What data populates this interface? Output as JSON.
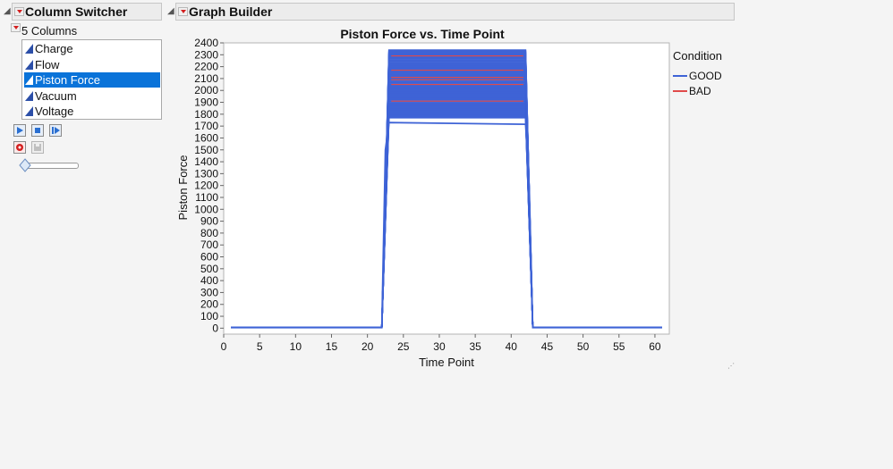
{
  "column_switcher": {
    "title": "Column Switcher",
    "count_label": "5 Columns",
    "columns": [
      {
        "label": "Charge",
        "selected": false
      },
      {
        "label": "Flow",
        "selected": false
      },
      {
        "label": "Piston Force",
        "selected": true
      },
      {
        "label": "Vacuum",
        "selected": false
      },
      {
        "label": "Voltage",
        "selected": false
      }
    ],
    "controls": [
      "play-icon",
      "stop-icon",
      "step-forward-icon",
      "record-icon",
      "save-icon"
    ],
    "slider_value": 0.1
  },
  "graph_builder": {
    "title": "Graph Builder"
  },
  "chart_data": {
    "type": "line",
    "title": "Piston Force vs. Time Point",
    "xlabel": "Time Point",
    "ylabel": "Piston Force",
    "xlim": [
      0,
      62
    ],
    "ylim": [
      -50,
      2400
    ],
    "x_ticks": [
      0,
      5,
      10,
      15,
      20,
      25,
      30,
      35,
      40,
      45,
      50,
      55,
      60
    ],
    "y_ticks": [
      0,
      100,
      200,
      300,
      400,
      500,
      600,
      700,
      800,
      900,
      1000,
      1100,
      1200,
      1300,
      1400,
      1500,
      1600,
      1700,
      1800,
      1900,
      2000,
      2100,
      2200,
      2300,
      2400
    ],
    "grid": false,
    "legend_title": "Condition",
    "legend_placement": "right",
    "series": [
      {
        "name": "GOOD",
        "color": "#3e63d6",
        "x": [
          1,
          22,
          22.5,
          23,
          42,
          42.5,
          43,
          61
        ],
        "plateau_range": [
          1770,
          2340
        ],
        "y_outlier": [
          5,
          5,
          1500,
          1730,
          1715,
          1200,
          5,
          5
        ]
      },
      {
        "name": "BAD",
        "color": "#e04a4a",
        "plateau_values": [
          1910,
          2050,
          2090,
          2110,
          2170,
          2290
        ]
      }
    ]
  }
}
